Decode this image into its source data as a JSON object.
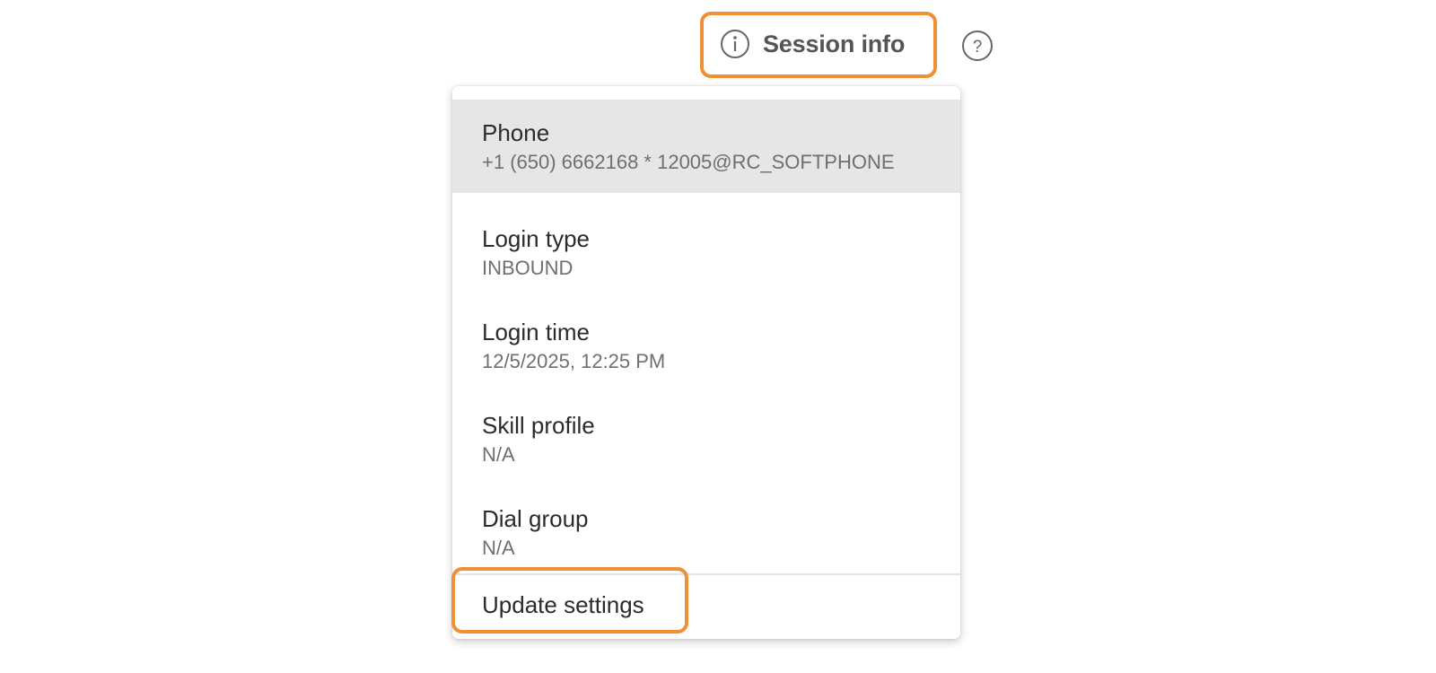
{
  "header": {
    "session_info_label": "Session info",
    "info_icon": "info-circle-icon",
    "help_icon": "question-circle-icon"
  },
  "menu": {
    "items": [
      {
        "title": "Phone",
        "value": "+1 (650) 6662168 * 12005@RC_SOFTPHONE",
        "selected": true
      },
      {
        "title": "Login type",
        "value": "INBOUND"
      },
      {
        "title": "Login time",
        "value": "12/5/2025, 12:25 PM"
      },
      {
        "title": "Skill profile",
        "value": "N/A"
      },
      {
        "title": "Dial group",
        "value": "N/A"
      }
    ],
    "action_label": "Update settings"
  },
  "colors": {
    "highlight": "#EE9033",
    "selected_row_bg": "#E6E6E6",
    "label_text": "#2b2b2b",
    "value_text": "#6f6f6f"
  }
}
